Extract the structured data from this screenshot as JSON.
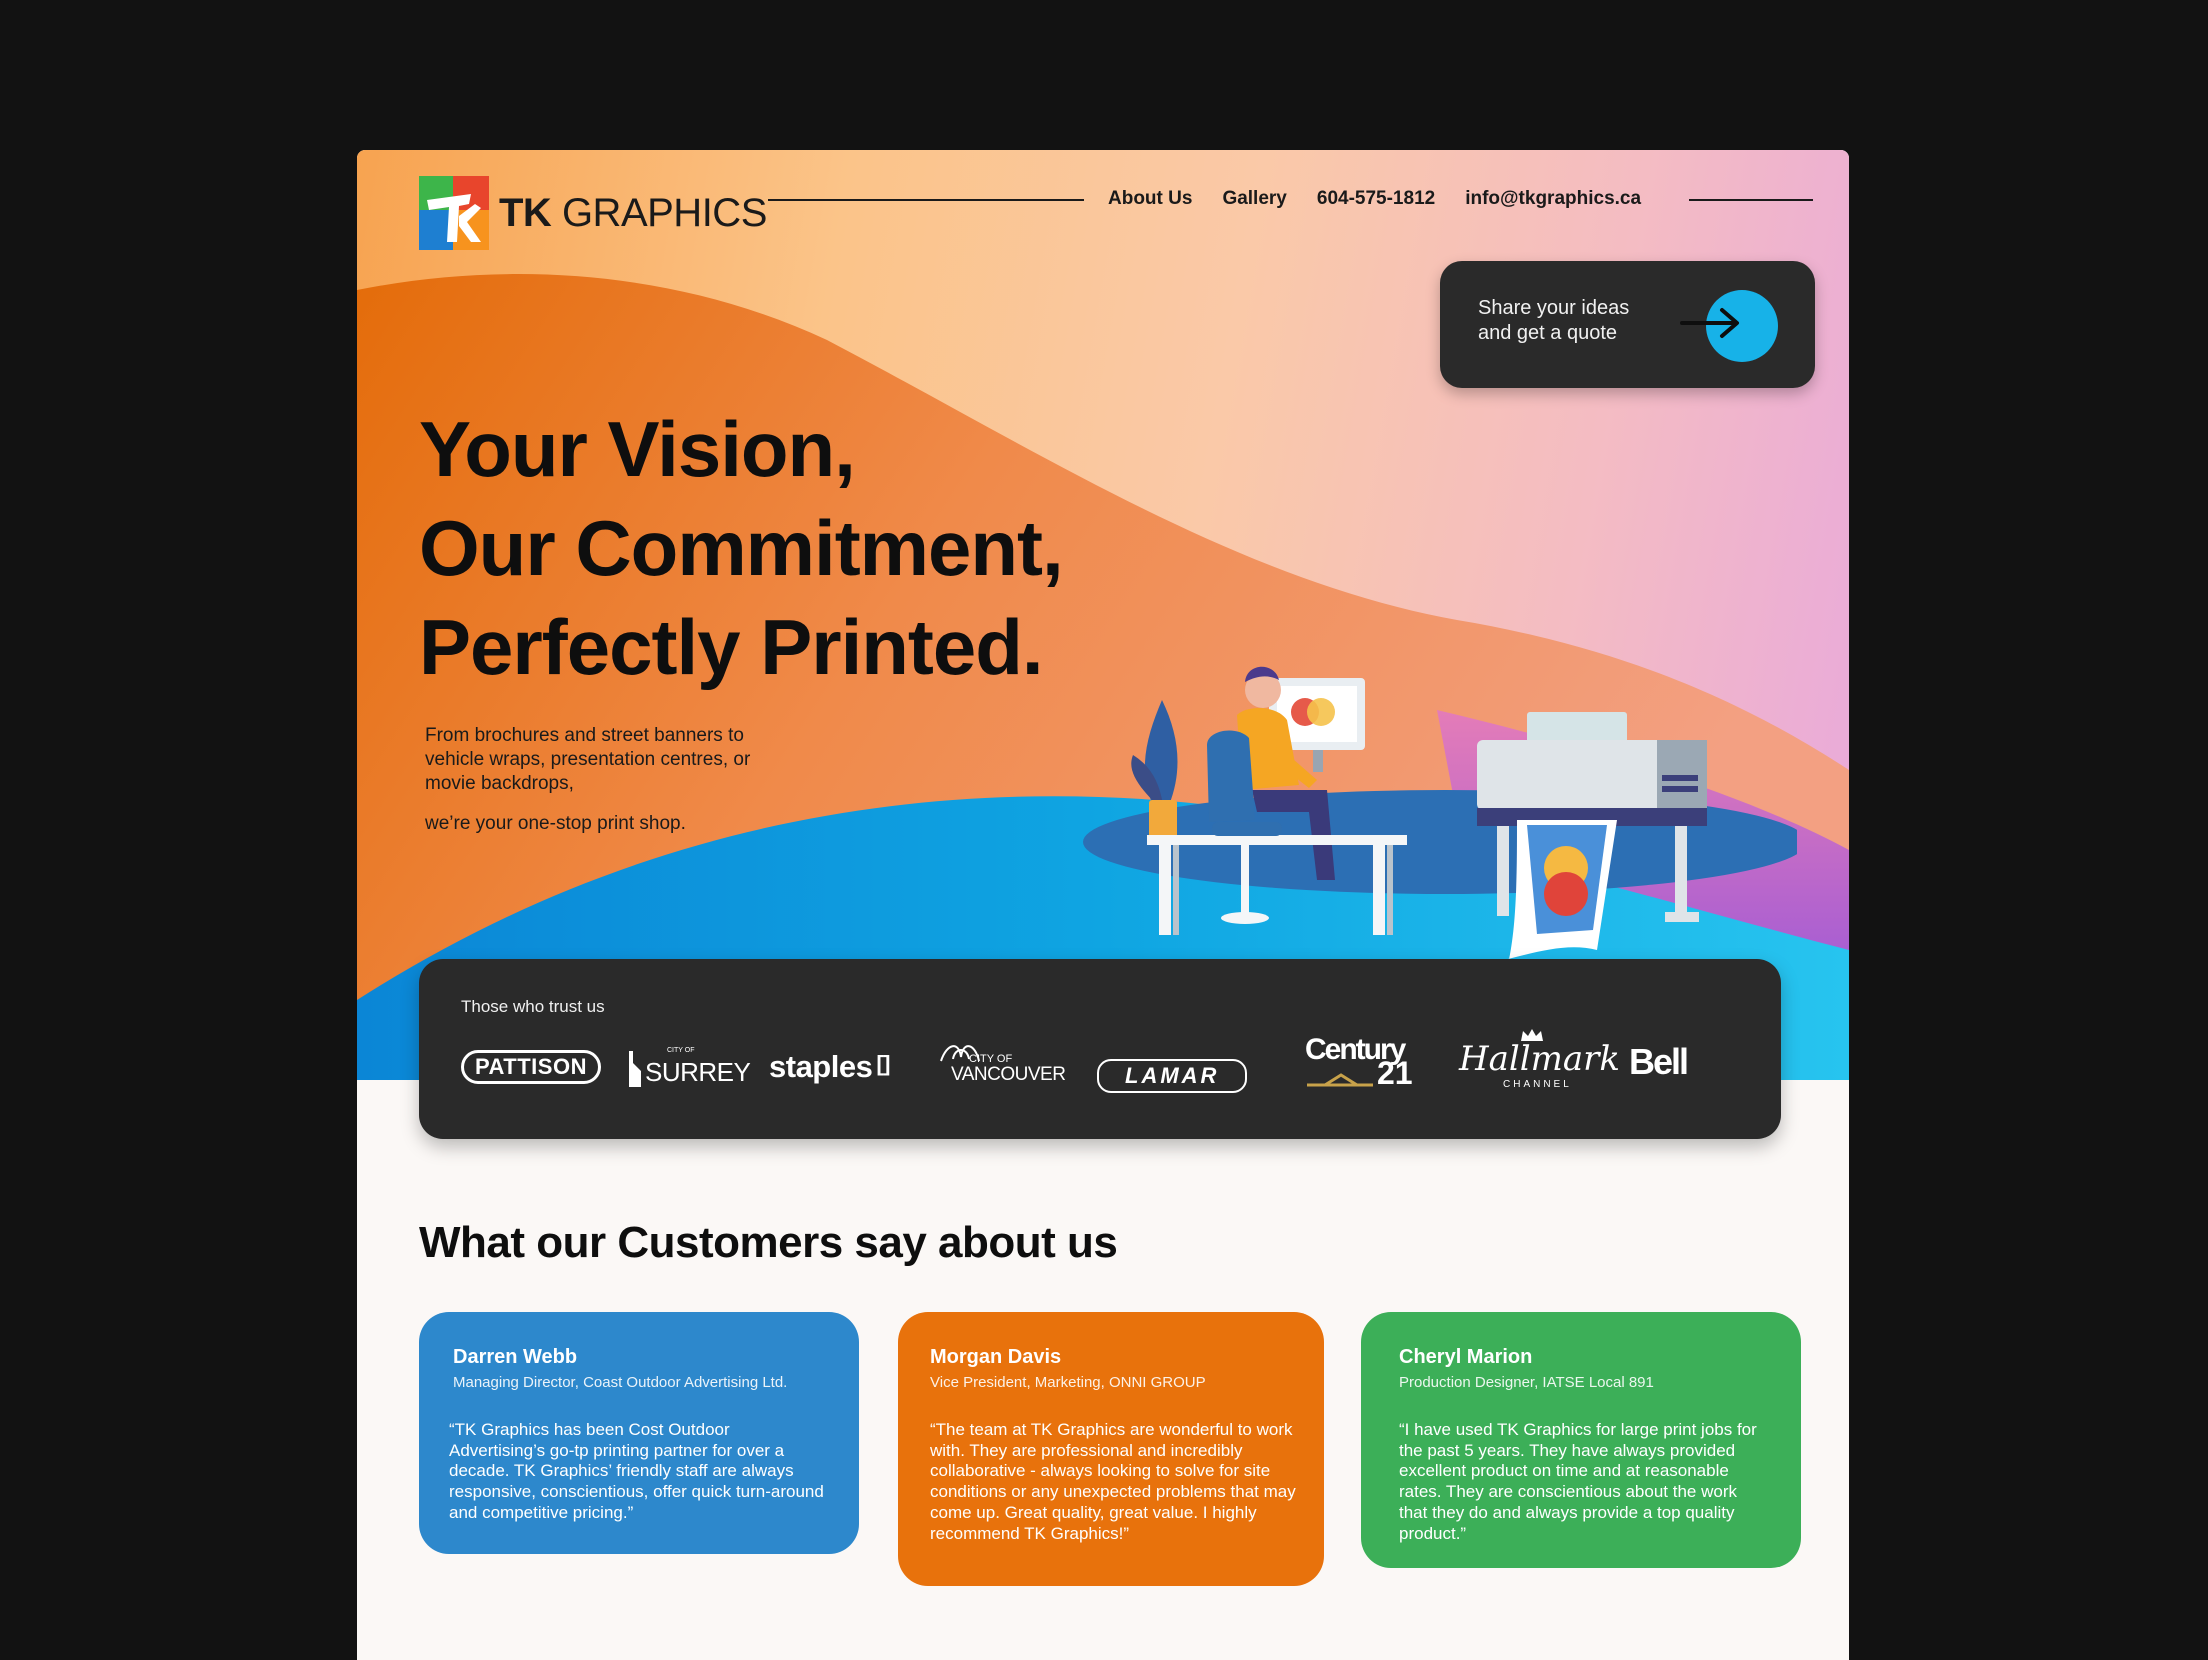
{
  "brand": {
    "logo_alt": "TK",
    "name_bold": "TK",
    "name_rest": " GRAPHICS"
  },
  "nav": {
    "about": "About Us",
    "gallery": "Gallery",
    "phone": "604-575-1812",
    "email": "info@tkgraphics.ca"
  },
  "cta": {
    "line1": "Share your ideas",
    "line2": "and get a quote",
    "icon": "arrow-right-icon"
  },
  "hero": {
    "headline": [
      "Your Vision,",
      "Our Commitment,",
      "Perfectly Printed."
    ],
    "subtext": "From brochures and street banners to vehicle wraps, presentation centres, or movie backdrops,",
    "subtext2": "we’re your one-stop print shop."
  },
  "trust": {
    "label": "Those who trust us",
    "clients": [
      "PATTISON",
      "SURREY",
      "staples",
      "VANCOUVER",
      "LAMAR",
      "Century 21",
      "Hallmark",
      "Bell"
    ],
    "client_small": {
      "surrey": "CITY OF",
      "vancouver": "CITY OF",
      "hallmark": "CHANNEL"
    }
  },
  "testimonials": {
    "title": "What our Customers say about us",
    "cards": [
      {
        "name": "Darren Webb",
        "role": "Managing Director, Coast Outdoor Advertising Ltd.",
        "quote": "“TK Graphics has been Cost Outdoor Advertising’s go-tp printing partner for over a decade. TK Graphics’ friendly staff are always responsive, conscientious, offer quick turn-around and competitive pricing.”",
        "color": "#2d88cc"
      },
      {
        "name": "Morgan Davis",
        "role": "Vice President, Marketing, ONNI GROUP",
        "quote": "“The team at TK Graphics are wonderful to work with. They are professional and incredibly collaborative - always looking to solve for site conditions or any unexpected problems that may come up. Great quality, great value. I highly recommend TK Graphics!”",
        "color": "#e8720c"
      },
      {
        "name": "Cheryl Marion",
        "role": "Production Designer, IATSE Local 891",
        "quote": "“I have used TK Graphics for large print jobs for the past 5 years. They have always provided excellent product on time and at reasonable rates. They are conscientious about the work that they do and always provide a top quality product.”",
        "color": "#3caf58"
      }
    ]
  }
}
